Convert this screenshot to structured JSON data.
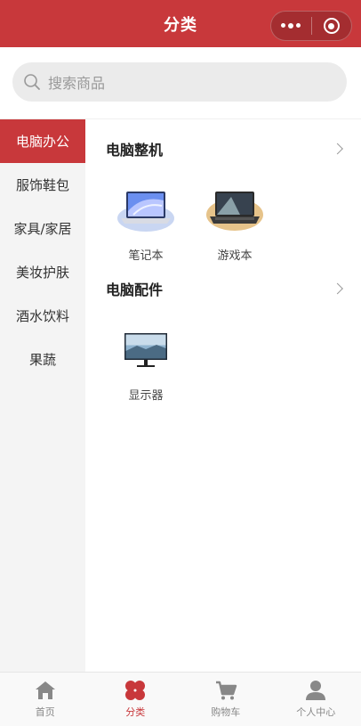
{
  "header": {
    "title": "分类",
    "bg_color": "#c8383b"
  },
  "search": {
    "placeholder": "搜索商品"
  },
  "sidebar": {
    "items": [
      {
        "label": "电脑办公",
        "active": true
      },
      {
        "label": "服饰鞋包",
        "active": false
      },
      {
        "label": "家具/家居",
        "active": false
      },
      {
        "label": "美妆护肤",
        "active": false
      },
      {
        "label": "酒水饮料",
        "active": false
      },
      {
        "label": "果蔬",
        "active": false
      }
    ]
  },
  "sections": [
    {
      "title": "电脑整机",
      "items": [
        {
          "label": "笔记本",
          "icon": "laptop-icon"
        },
        {
          "label": "游戏本",
          "icon": "gaming-laptop-icon"
        }
      ]
    },
    {
      "title": "电脑配件",
      "items": [
        {
          "label": "显示器",
          "icon": "monitor-icon"
        }
      ]
    }
  ],
  "tabbar": {
    "items": [
      {
        "label": "首页",
        "icon": "home-icon",
        "active": false
      },
      {
        "label": "分类",
        "icon": "category-icon",
        "active": true
      },
      {
        "label": "购物车",
        "icon": "cart-icon",
        "active": false
      },
      {
        "label": "个人中心",
        "icon": "user-icon",
        "active": false
      }
    ],
    "active_color": "#c8383b",
    "inactive_color": "#888888"
  }
}
